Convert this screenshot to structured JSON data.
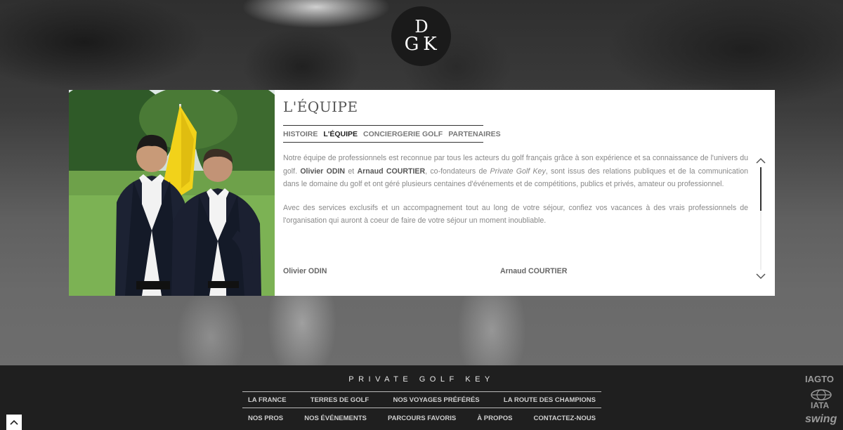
{
  "logo": {
    "letters": [
      "D",
      "G",
      "K"
    ]
  },
  "section": {
    "title": "L'ÉQUIPE"
  },
  "tabs": [
    {
      "label": "HISTOIRE"
    },
    {
      "label": "L'ÉQUIPE"
    },
    {
      "label": "CONCIERGERIE GOLF"
    },
    {
      "label": "PARTENAIRES"
    }
  ],
  "body": {
    "p1": {
      "t1": "Notre équipe de professionnels est reconnue par tous les acteurs du golf français grâce à son expérience et sa connaissance de l'univers du golf. ",
      "name1": "Olivier ODIN",
      "t2": " et ",
      "name2": "Arnaud COURTIER",
      "t3": ", co-fondateurs de ",
      "brand": "Private Golf Key",
      "t4": ", sont issus des relations publiques et de la communication dans le domaine du golf et ont géré plusieurs centaines d'événements et de compétitions, publics et privés, amateur ou professionnel."
    },
    "p2": "Avec des services exclusifs et un accompagnement tout au long de votre séjour, confiez vos vacances à des vrais professionnels de l'organisation qui auront à coeur de faire de votre séjour un moment inoubliable."
  },
  "people": [
    {
      "name": "Olivier ODIN"
    },
    {
      "name": "Arnaud COURTIER"
    }
  ],
  "footer": {
    "title": "PRIVATE GOLF KEY",
    "nav_row1": [
      "LA FRANCE",
      "TERRES DE GOLF",
      "NOS VOYAGES PRÉFÉRÉS",
      "LA ROUTE DES CHAMPIONS"
    ],
    "nav_row2": [
      "NOS PROS",
      "NOS ÉVÉNEMENTS",
      "PARCOURS FAVORIS",
      "À PROPOS",
      "CONTACTEZ-NOUS"
    ],
    "badges": [
      "IAGTO",
      "IATA",
      "swing"
    ]
  },
  "icons": {
    "scroll_up": "chevron-up-icon",
    "scroll_down": "chevron-down-icon",
    "back_to_top": "chevron-up-icon"
  },
  "colors": {
    "footer_bg": "#1f1f1f",
    "panel_bg": "#ffffff",
    "logo_bg": "#1a1a1a"
  }
}
